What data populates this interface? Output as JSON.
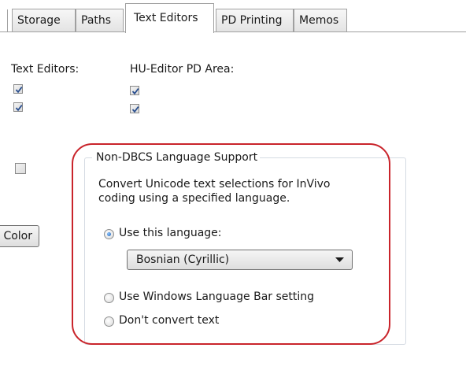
{
  "tabs": [
    {
      "label": "Storage"
    },
    {
      "label": "Paths"
    },
    {
      "label": "Text Editors",
      "active": true
    },
    {
      "label": "PD Printing"
    },
    {
      "label": "Memos"
    }
  ],
  "columns": {
    "text_editors_label": "Text Editors:",
    "hu_editor_label": "HU-Editor PD Area:"
  },
  "checkboxes": {
    "text_editors_1": true,
    "text_editors_2": true,
    "hu_editor_1": true,
    "hu_editor_2": true,
    "extra_option": false
  },
  "color_button_label": "Color",
  "language_group": {
    "title": "Non-DBCS Language Support",
    "description_line1": "Convert Unicode text selections for InVivo",
    "description_line2": "coding using a specified language.",
    "options": [
      {
        "label": "Use this language:",
        "selected": true
      },
      {
        "label": "Use Windows Language Bar setting",
        "selected": false
      },
      {
        "label": "Don't convert text",
        "selected": false
      }
    ],
    "language_value": "Bosnian (Cyrillic)"
  },
  "colors": {
    "highlight": "#c9242b",
    "check_mark": "#2a4f8f",
    "radio_selected": "#1d5fb3"
  }
}
